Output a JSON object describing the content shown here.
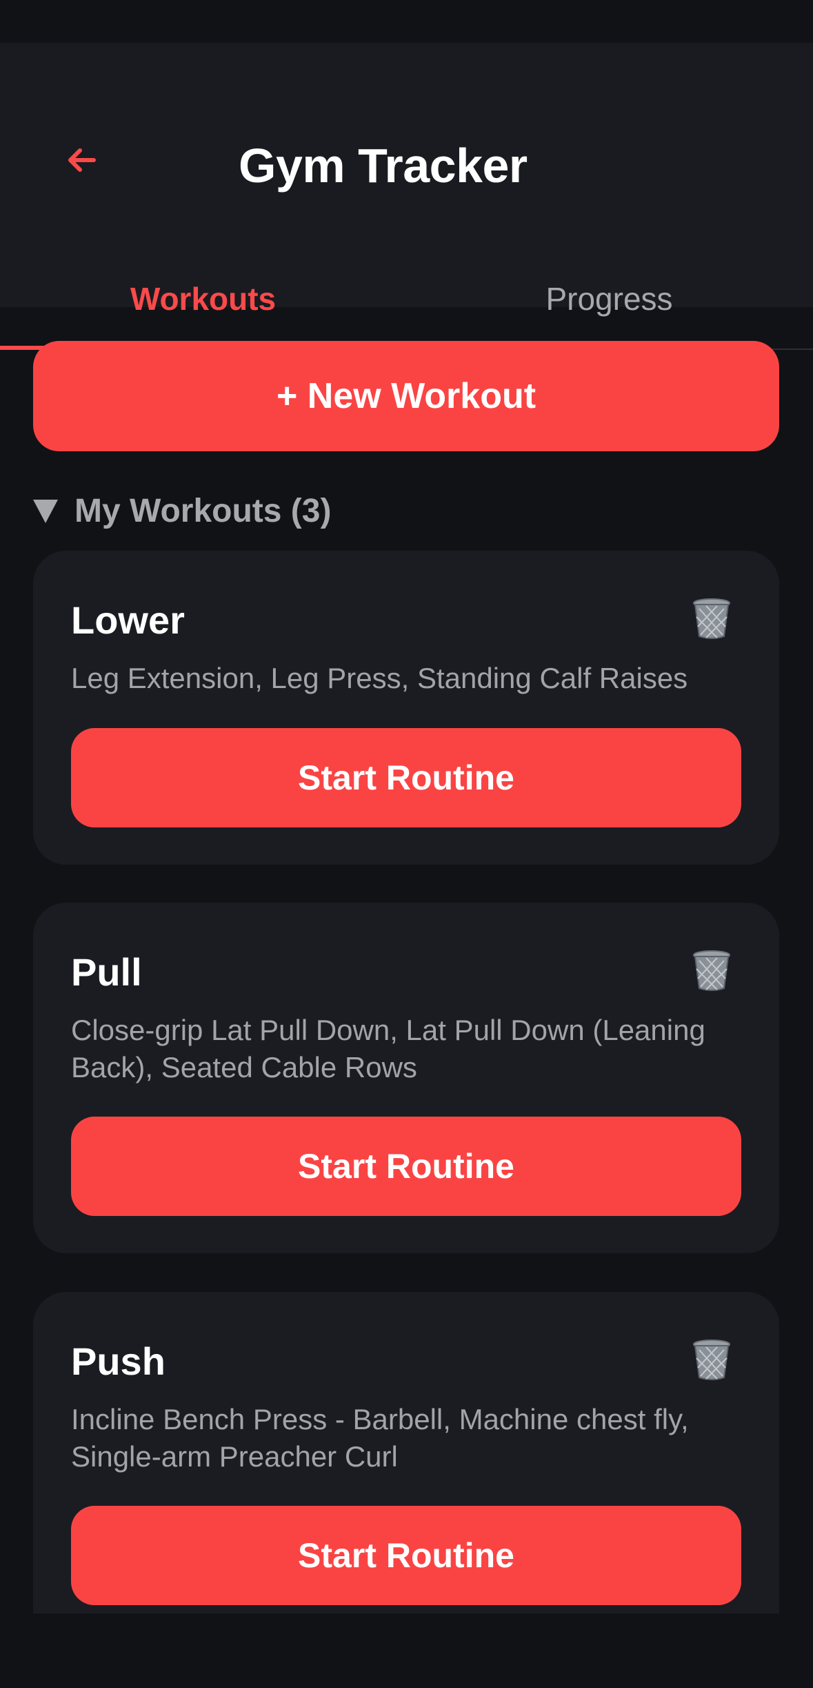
{
  "header": {
    "back_icon": "arrow-left-icon",
    "title": "Gym Tracker"
  },
  "tabs": [
    {
      "label": "Workouts",
      "active": true
    },
    {
      "label": "Progress",
      "active": false
    }
  ],
  "new_workout_label": "+ New Workout",
  "section": {
    "label": "My Workouts (3)",
    "expanded": true
  },
  "workouts": [
    {
      "name": "Lower",
      "exercises": "Leg Extension, Leg Press, Standing Calf Raises",
      "action_label": "Start Routine"
    },
    {
      "name": "Pull",
      "exercises": "Close-grip Lat Pull Down, Lat Pull Down (Leaning Back), Seated Cable Rows",
      "action_label": "Start Routine"
    },
    {
      "name": "Push",
      "exercises": "Incline Bench Press - Barbell, Machine chest fly, Single-arm Preacher Curl",
      "action_label": "Start Routine"
    }
  ],
  "colors": {
    "accent": "#fa4444",
    "background": "#111216",
    "surface": "#1b1c21",
    "text_primary": "#ffffff",
    "text_secondary": "#a8a8ad"
  },
  "icons": {
    "delete": "trash-icon",
    "collapse": "triangle-down-icon"
  }
}
